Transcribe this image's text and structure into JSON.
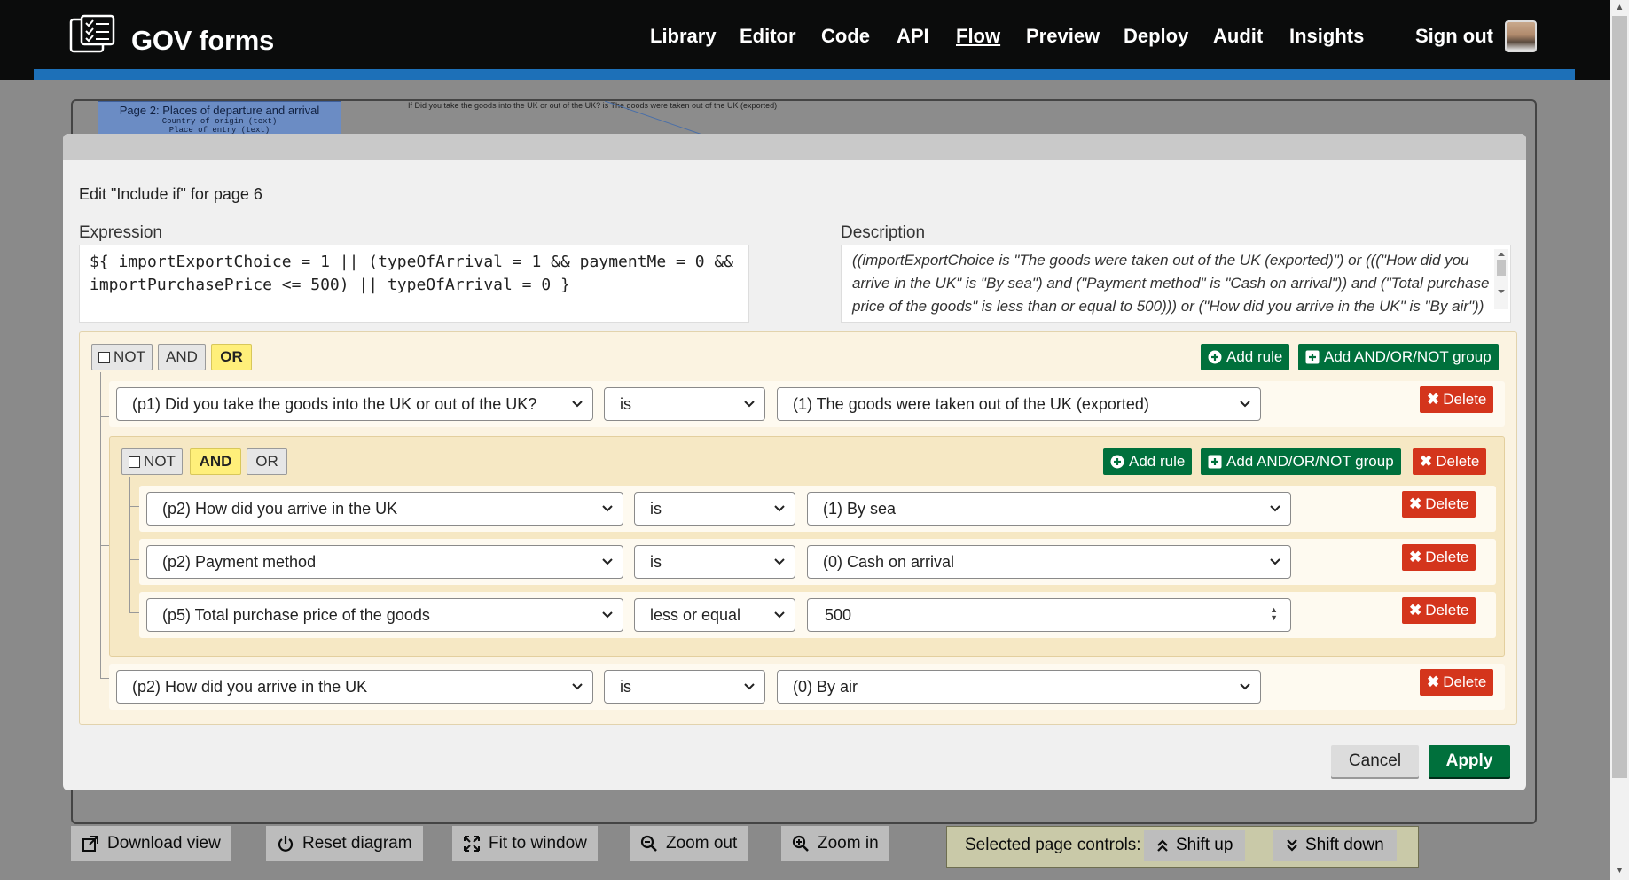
{
  "header": {
    "brand": "GOV forms",
    "nav": [
      "Library",
      "Editor",
      "Code",
      "API",
      "Flow",
      "Preview",
      "Deploy",
      "Audit",
      "Insights",
      "Sign out"
    ],
    "active_nav": "Flow"
  },
  "diagram": {
    "node_title": "Page 2: Places of departure and arrival",
    "node_field_1": "Country of origin (text)",
    "node_field_2": "Place of entry (text)",
    "edge_label": "If Did you take the goods into the UK or out of the UK? is The goods were taken out of the UK (exported)"
  },
  "modal": {
    "title": "Edit \"Include if\" for page 6",
    "expression_label": "Expression",
    "expression_value": "${ importExportChoice = 1 || (typeOfArrival = 1 && paymentMe = 0 && importPurchasePrice <= 500) || typeOfArrival = 0 }",
    "description_label": "Description",
    "description_value": "((importExportChoice is \"The goods were taken out of the UK (exported)\") or (((\"How did you arrive in the UK\" is \"By sea\") and (\"Payment method\" is \"Cash on arrival\")) and (\"Total purchase price of the goods\" is less than or equal to 500))) or (\"How did you arrive in the UK\" is \"By air\"))",
    "cancel_label": "Cancel",
    "apply_label": "Apply"
  },
  "builder": {
    "not_label": "NOT",
    "and_label": "AND",
    "or_label": "OR",
    "add_rule_label": "Add rule",
    "add_group_label": "Add AND/OR/NOT group",
    "delete_label": "Delete",
    "outer_combinator": "OR",
    "inner_combinator": "AND",
    "rules": {
      "r1": {
        "field": "(p1) Did you take the goods into the UK or out of the UK?",
        "operator": "is",
        "value": "(1) The goods were taken out of the UK (exported)"
      },
      "r2": {
        "field": "(p2) How did you arrive in the UK",
        "operator": "is",
        "value": "(1) By sea"
      },
      "r3": {
        "field": "(p2) Payment method",
        "operator": "is",
        "value": "(0) Cash on arrival"
      },
      "r4": {
        "field": "(p5) Total purchase price of the goods",
        "operator": "less or equal",
        "value": "500"
      },
      "r5": {
        "field": "(p2) How did you arrive in the UK",
        "operator": "is",
        "value": "(0) By air"
      }
    }
  },
  "toolbar": {
    "download": "Download view",
    "reset": "Reset diagram",
    "fit": "Fit to window",
    "zoom_out": "Zoom out",
    "zoom_in": "Zoom in",
    "selected_label": "Selected page controls:",
    "shift_up": "Shift up",
    "shift_down": "Shift down"
  },
  "colors": {
    "header_bg": "#0b0c0c",
    "accent_blue": "#1d70b8",
    "primary_green": "#00703c",
    "danger_red": "#d4351c",
    "active_toggle": "#ffef7a"
  }
}
